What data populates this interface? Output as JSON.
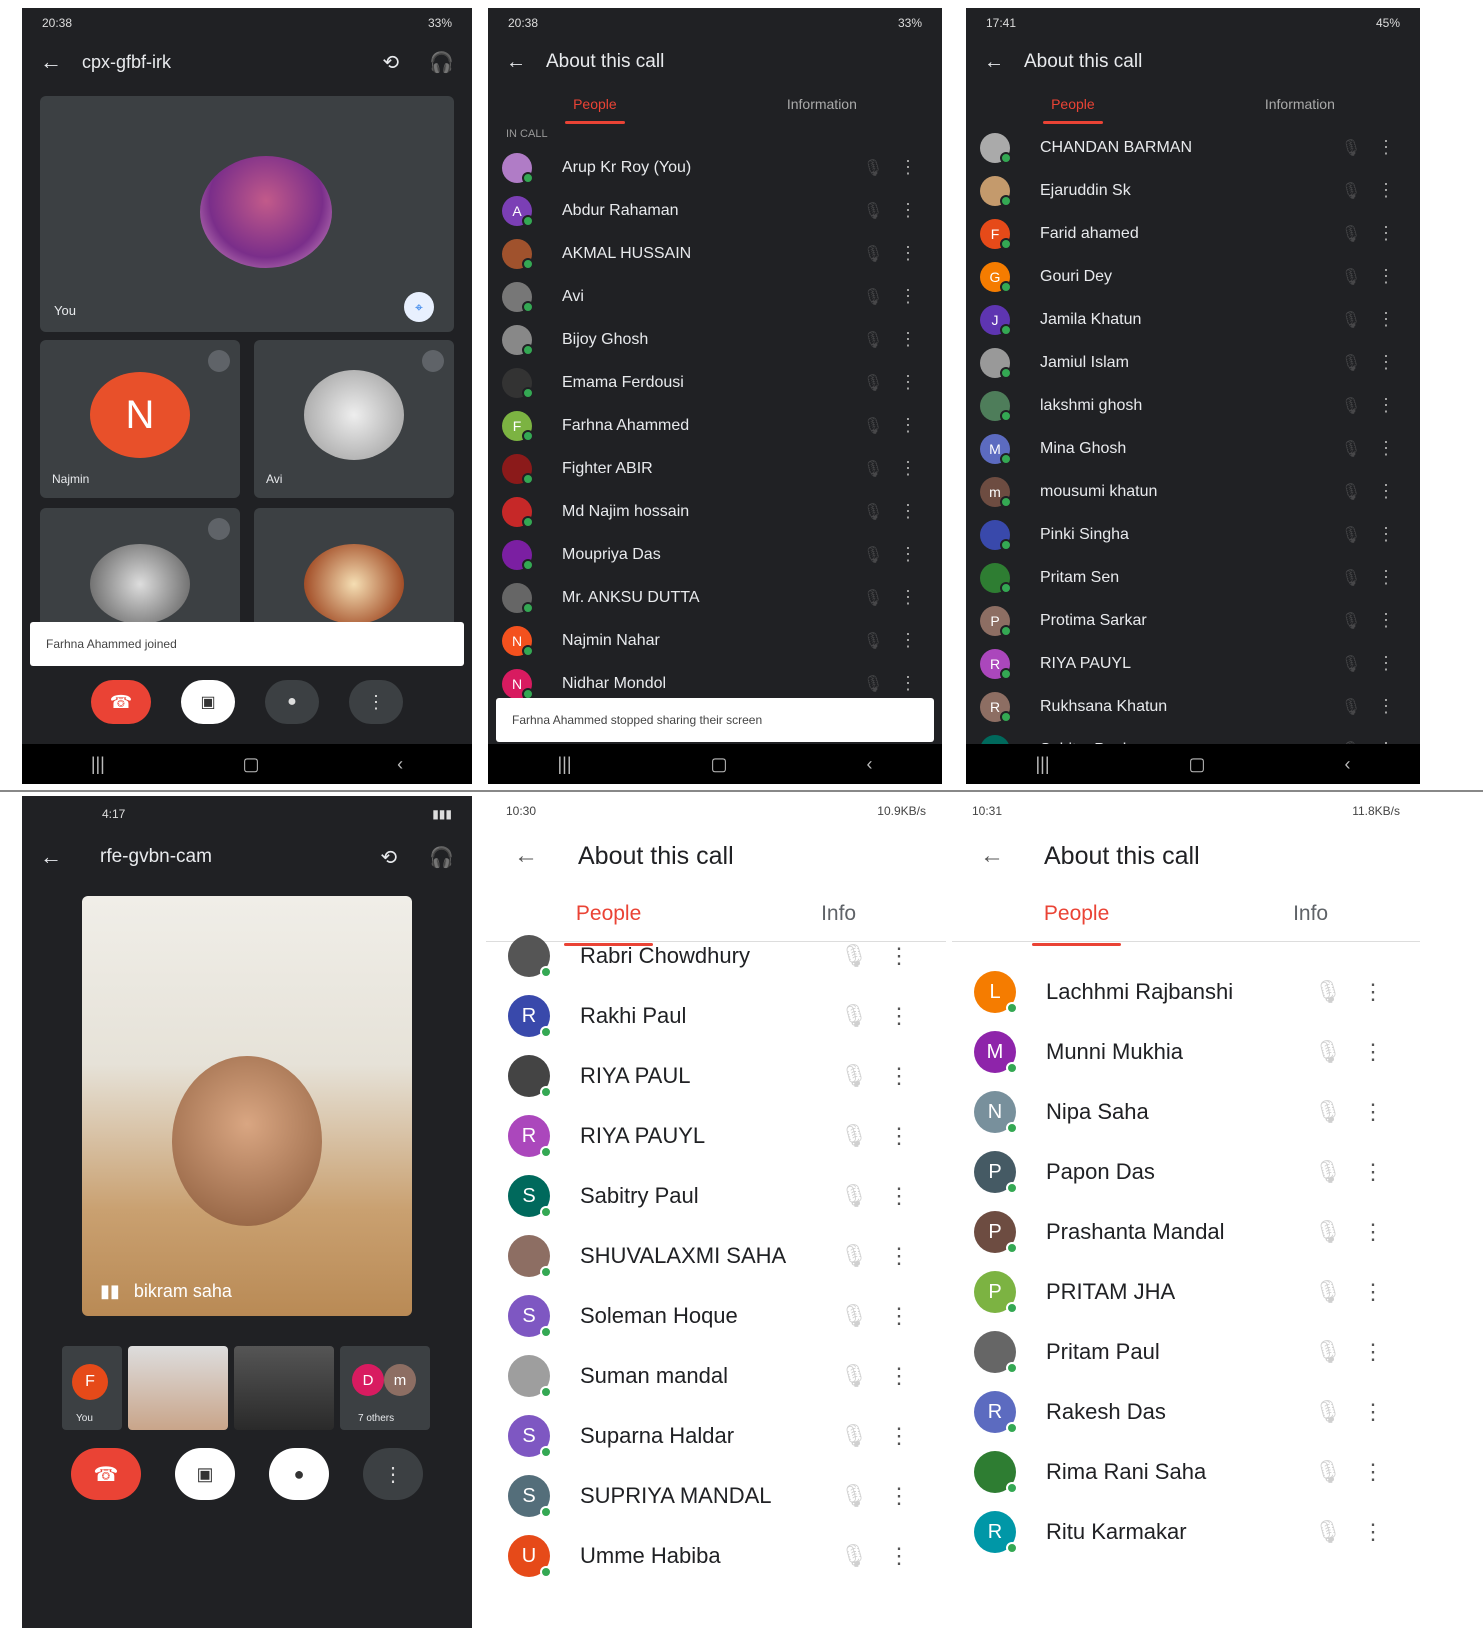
{
  "p1": {
    "status": {
      "time": "20:38",
      "right": "33%"
    },
    "meeting_code": "cpx-gfbf-irk",
    "tiles": [
      {
        "label": "You"
      },
      {
        "label": "Najmin",
        "initial": "N"
      },
      {
        "label": "Avi"
      }
    ],
    "toast": "Farhna Ahammed joined"
  },
  "p2": {
    "status": {
      "time": "20:38",
      "right": "33%"
    },
    "title": "About this call",
    "tabs": [
      "People",
      "Information"
    ],
    "section": "IN CALL",
    "people": [
      {
        "name": "Arup Kr Roy (You)",
        "initial": "",
        "color": "#b07cc6"
      },
      {
        "name": "Abdur Rahaman",
        "initial": "A",
        "color": "#7b3fb5"
      },
      {
        "name": "AKMAL HUSSAIN",
        "initial": "",
        "color": "#a0522d"
      },
      {
        "name": "Avi",
        "initial": "",
        "color": "#777"
      },
      {
        "name": "Bijoy Ghosh",
        "initial": "",
        "color": "#888"
      },
      {
        "name": "Emama Ferdousi",
        "initial": "",
        "color": "#333"
      },
      {
        "name": "Farhna Ahammed",
        "initial": "F",
        "color": "#7cb342"
      },
      {
        "name": "Fighter ABIR",
        "initial": "",
        "color": "#8b1a1a"
      },
      {
        "name": "Md Najim hossain",
        "initial": "",
        "color": "#c62828"
      },
      {
        "name": "Moupriya Das",
        "initial": "",
        "color": "#7b1fa2"
      },
      {
        "name": "Mr. ANKSU DUTTA",
        "initial": "",
        "color": "#666"
      },
      {
        "name": "Najmin Nahar",
        "initial": "N",
        "color": "#f4511e"
      },
      {
        "name": "Nidhar Mondol",
        "initial": "N",
        "color": "#d81b60"
      }
    ],
    "toast": "Farhna Ahammed stopped sharing their screen"
  },
  "p3": {
    "status": {
      "time": "17:41",
      "right": "45%"
    },
    "title": "About this call",
    "tabs": [
      "People",
      "Information"
    ],
    "people": [
      {
        "name": "CHANDAN BARMAN",
        "initial": "",
        "color": "#aaa"
      },
      {
        "name": "Ejaruddin Sk",
        "initial": "",
        "color": "#c49a6c"
      },
      {
        "name": "Farid ahamed",
        "initial": "F",
        "color": "#e64a19"
      },
      {
        "name": "Gouri Dey",
        "initial": "G",
        "color": "#f57c00"
      },
      {
        "name": "Jamila Khatun",
        "initial": "J",
        "color": "#5e35b1"
      },
      {
        "name": "Jamiul Islam",
        "initial": "",
        "color": "#999"
      },
      {
        "name": "lakshmi ghosh",
        "initial": "",
        "color": "#4e7d5a"
      },
      {
        "name": "Mina Ghosh",
        "initial": "M",
        "color": "#5c6bc0"
      },
      {
        "name": "mousumi khatun",
        "initial": "m",
        "color": "#6d4c41"
      },
      {
        "name": "Pinki Singha",
        "initial": "",
        "color": "#3949ab"
      },
      {
        "name": "Pritam Sen",
        "initial": "",
        "color": "#2e7d32"
      },
      {
        "name": "Protima Sarkar",
        "initial": "P",
        "color": "#8d6e63"
      },
      {
        "name": "RIYA PAUYL",
        "initial": "R",
        "color": "#ab47bc"
      },
      {
        "name": "Rukhsana Khatun",
        "initial": "R",
        "color": "#8d6e63"
      },
      {
        "name": "Sabitry Paul",
        "initial": "S",
        "color": "#00695c"
      }
    ]
  },
  "p4": {
    "status": {
      "time": "4:17"
    },
    "meeting_code": "rfe-gvbn-cam",
    "speaker": "bikram saha",
    "thumbs": [
      "You",
      "7 others"
    ],
    "thumb_initials": [
      "F",
      "D",
      "m"
    ]
  },
  "p5": {
    "status": {
      "time": "10:30",
      "right": "10.9KB/s"
    },
    "title": "About this call",
    "tabs": [
      "People",
      "Info"
    ],
    "people": [
      {
        "name": "Rabri Chowdhury",
        "initial": "",
        "color": "#555"
      },
      {
        "name": "Rakhi Paul",
        "initial": "R",
        "color": "#3949ab"
      },
      {
        "name": "RIYA PAUL",
        "initial": "",
        "color": "#444"
      },
      {
        "name": "RIYA PAUYL",
        "initial": "R",
        "color": "#ab47bc"
      },
      {
        "name": "Sabitry Paul",
        "initial": "S",
        "color": "#00695c"
      },
      {
        "name": "SHUVALAXMI SAHA",
        "initial": "",
        "color": "#8d6e63"
      },
      {
        "name": "Soleman Hoque",
        "initial": "S",
        "color": "#7e57c2"
      },
      {
        "name": "Suman mandal",
        "initial": "",
        "color": "#9e9e9e"
      },
      {
        "name": "Suparna Haldar",
        "initial": "S",
        "color": "#7e57c2"
      },
      {
        "name": "SUPRIYA MANDAL",
        "initial": "S",
        "color": "#546e7a"
      },
      {
        "name": "Umme Habiba",
        "initial": "U",
        "color": "#e64a19"
      }
    ]
  },
  "p6": {
    "status": {
      "time": "10:31",
      "right": "11.8KB/s"
    },
    "title": "About this call",
    "tabs": [
      "People",
      "Info"
    ],
    "people": [
      {
        "name": "Lachhmi Rajbanshi",
        "initial": "L",
        "color": "#f57c00"
      },
      {
        "name": "Munni Mukhia",
        "initial": "M",
        "color": "#8e24aa"
      },
      {
        "name": "Nipa Saha",
        "initial": "N",
        "color": "#78909c"
      },
      {
        "name": "Papon Das",
        "initial": "P",
        "color": "#455a64"
      },
      {
        "name": "Prashanta Mandal",
        "initial": "P",
        "color": "#6d4c41"
      },
      {
        "name": "PRITAM JHA",
        "initial": "P",
        "color": "#7cb342"
      },
      {
        "name": "Pritam Paul",
        "initial": "",
        "color": "#666"
      },
      {
        "name": "Rakesh Das",
        "initial": "R",
        "color": "#5c6bc0"
      },
      {
        "name": "Rima Rani Saha",
        "initial": "",
        "color": "#2e7d32"
      },
      {
        "name": "Ritu Karmakar",
        "initial": "R",
        "color": "#0097a7"
      }
    ]
  }
}
